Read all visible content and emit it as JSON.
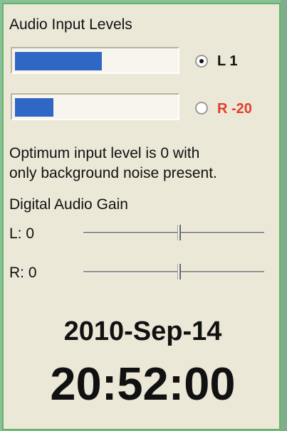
{
  "audio_input": {
    "title": "Audio Input Levels",
    "channels": [
      {
        "label": "L 1",
        "level_fraction": 0.54,
        "selected": true,
        "label_color": "#111111"
      },
      {
        "label": "R -20",
        "level_fraction": 0.24,
        "selected": false,
        "label_color": "#e33c2c"
      }
    ]
  },
  "info_text": {
    "line1": "Optimum input level is 0 with",
    "line2": "only background noise present."
  },
  "gain": {
    "title": "Digital Audio Gain",
    "left_label": "L: 0",
    "right_label": "R: 0",
    "left_value_fraction": 0.52,
    "right_value_fraction": 0.52
  },
  "clock": {
    "date": "2010-Sep-14",
    "time": "20:52:00"
  },
  "colors": {
    "panel": "#ece8d8",
    "border": "#5cb85c",
    "meter_fill": "#2f68c4",
    "outside": "#8cbd9c"
  }
}
